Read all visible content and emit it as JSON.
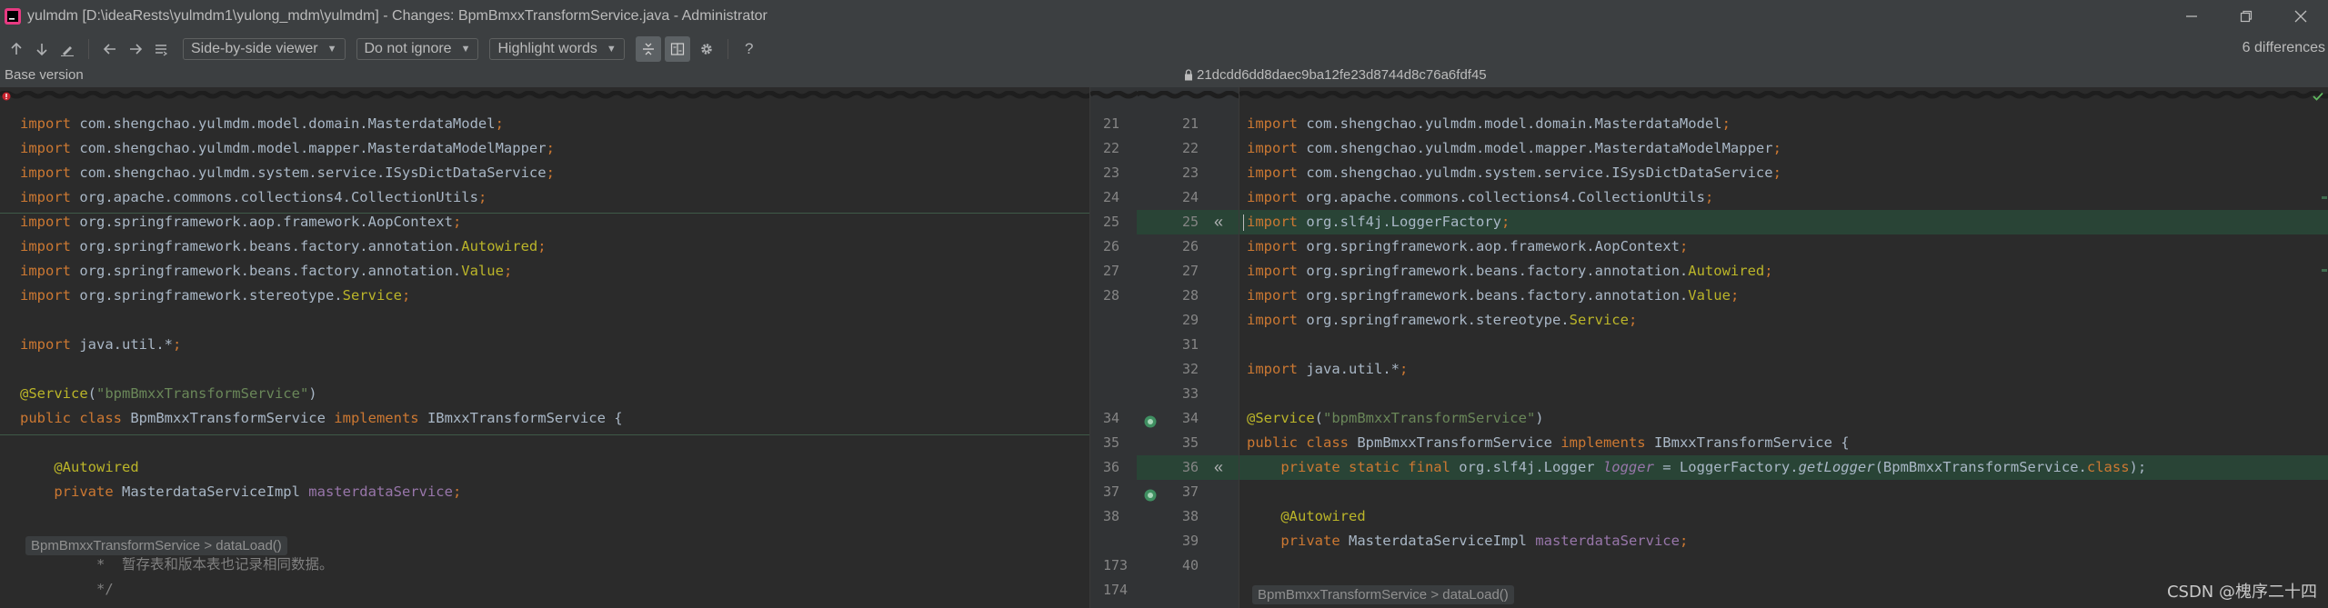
{
  "window": {
    "title": "yulmdm [D:\\ideaRests\\yulmdm1\\yulong_mdm\\yulmdm] - Changes: BpmBmxxTransformService.java - Administrator",
    "controls": [
      "minimize-icon",
      "restore-icon",
      "close-icon"
    ]
  },
  "toolbar": {
    "viewer_mode": "Side-by-side viewer",
    "whitespace_mode": "Do not ignore",
    "highlight_mode": "Highlight words",
    "help_label": "?",
    "differences_count": "6 differences"
  },
  "header": {
    "base_version": "Base version",
    "revision_hash": "21dcdd6dd8daec9ba12fe23d8744d8c76a6fdf45"
  },
  "left": {
    "lines": [
      {
        "tokens": [
          {
            "t": "import ",
            "c": "kw"
          },
          {
            "t": "com.shengchao.yulmdm.model.domain.MasterdataModel",
            "c": "pl"
          },
          {
            "t": ";",
            "c": "kw"
          }
        ]
      },
      {
        "tokens": [
          {
            "t": "import ",
            "c": "kw"
          },
          {
            "t": "com.shengchao.yulmdm.model.mapper.MasterdataModelMapper",
            "c": "pl"
          },
          {
            "t": ";",
            "c": "kw"
          }
        ]
      },
      {
        "tokens": [
          {
            "t": "import ",
            "c": "kw"
          },
          {
            "t": "com.shengchao.yulmdm.system.service.ISysDictDataService",
            "c": "pl"
          },
          {
            "t": ";",
            "c": "kw"
          }
        ]
      },
      {
        "tokens": [
          {
            "t": "import ",
            "c": "kw"
          },
          {
            "t": "org.apache.commons.collections4.CollectionUtils",
            "c": "pl"
          },
          {
            "t": ";",
            "c": "kw"
          }
        ]
      },
      {
        "tokens": [
          {
            "t": "import ",
            "c": "kw"
          },
          {
            "t": "org.springframework.aop.framework.AopContext",
            "c": "pl"
          },
          {
            "t": ";",
            "c": "kw"
          }
        ]
      },
      {
        "tokens": [
          {
            "t": "import ",
            "c": "kw"
          },
          {
            "t": "org.springframework.beans.factory.annotation.",
            "c": "pl"
          },
          {
            "t": "Autowired",
            "c": "an"
          },
          {
            "t": ";",
            "c": "kw"
          }
        ]
      },
      {
        "tokens": [
          {
            "t": "import ",
            "c": "kw"
          },
          {
            "t": "org.springframework.beans.factory.annotation.",
            "c": "pl"
          },
          {
            "t": "Value",
            "c": "an"
          },
          {
            "t": ";",
            "c": "kw"
          }
        ]
      },
      {
        "tokens": [
          {
            "t": "import ",
            "c": "kw"
          },
          {
            "t": "org.springframework.stereotype.",
            "c": "pl"
          },
          {
            "t": "Service",
            "c": "an"
          },
          {
            "t": ";",
            "c": "kw"
          }
        ]
      },
      {
        "tokens": []
      },
      {
        "tokens": [
          {
            "t": "import ",
            "c": "kw"
          },
          {
            "t": "java.util.*",
            "c": "pl"
          },
          {
            "t": ";",
            "c": "kw"
          }
        ]
      },
      {
        "tokens": []
      },
      {
        "tokens": [
          {
            "t": "@Service",
            "c": "an"
          },
          {
            "t": "(",
            "c": "pl"
          },
          {
            "t": "\"bpmBmxxTransformService\"",
            "c": "st"
          },
          {
            "t": ")",
            "c": "pl"
          }
        ]
      },
      {
        "tokens": [
          {
            "t": "public class ",
            "c": "kw"
          },
          {
            "t": "BpmBmxxTransformService ",
            "c": "pl"
          },
          {
            "t": "implements ",
            "c": "kw"
          },
          {
            "t": "IBmxxTransformService {",
            "c": "pl"
          }
        ]
      },
      {
        "tokens": []
      },
      {
        "tokens": [
          {
            "t": "    @Autowired",
            "c": "an"
          }
        ]
      },
      {
        "tokens": [
          {
            "t": "    private ",
            "c": "kw"
          },
          {
            "t": "MasterdataServiceImpl ",
            "c": "pl"
          },
          {
            "t": "masterdataService",
            "c": "fd"
          },
          {
            "t": ";",
            "c": "kw"
          }
        ]
      }
    ],
    "fold_label": "BpmBmxxTransformService > dataLoad()",
    "comment_lines": [
      "         *  暂存表和版本表也记录相同数据。",
      "         */"
    ]
  },
  "gutter": {
    "left_numbers": [
      "21",
      "22",
      "23",
      "24",
      "25",
      "26",
      "27",
      "28",
      "",
      "",
      "",
      "",
      "34",
      "35",
      "36",
      "37",
      "38",
      "",
      "173",
      "174"
    ],
    "right_numbers": [
      "21",
      "22",
      "23",
      "24",
      "25",
      "26",
      "27",
      "28",
      "29",
      "31",
      "32",
      "33",
      "34",
      "35",
      "36",
      "37",
      "38",
      "39",
      "40",
      ""
    ]
  },
  "right": {
    "lines": [
      {
        "tokens": [
          {
            "t": "import ",
            "c": "kw"
          },
          {
            "t": "com.shengchao.yulmdm.model.domain.MasterdataModel",
            "c": "pl"
          },
          {
            "t": ";",
            "c": "kw"
          }
        ]
      },
      {
        "tokens": [
          {
            "t": "import ",
            "c": "kw"
          },
          {
            "t": "com.shengchao.yulmdm.model.mapper.MasterdataModelMapper",
            "c": "pl"
          },
          {
            "t": ";",
            "c": "kw"
          }
        ]
      },
      {
        "tokens": [
          {
            "t": "import ",
            "c": "kw"
          },
          {
            "t": "com.shengchao.yulmdm.system.service.ISysDictDataService",
            "c": "pl"
          },
          {
            "t": ";",
            "c": "kw"
          }
        ]
      },
      {
        "tokens": [
          {
            "t": "import ",
            "c": "kw"
          },
          {
            "t": "org.apache.commons.collections4.CollectionUtils",
            "c": "pl"
          },
          {
            "t": ";",
            "c": "kw"
          }
        ]
      },
      {
        "tokens": [
          {
            "t": "import ",
            "c": "kw"
          },
          {
            "t": "org.slf4j.LoggerFactory",
            "c": "pl"
          },
          {
            "t": ";",
            "c": "kw"
          }
        ]
      },
      {
        "tokens": [
          {
            "t": "import ",
            "c": "kw"
          },
          {
            "t": "org.springframework.aop.framework.AopContext",
            "c": "pl"
          },
          {
            "t": ";",
            "c": "kw"
          }
        ]
      },
      {
        "tokens": [
          {
            "t": "import ",
            "c": "kw"
          },
          {
            "t": "org.springframework.beans.factory.annotation.",
            "c": "pl"
          },
          {
            "t": "Autowired",
            "c": "an"
          },
          {
            "t": ";",
            "c": "kw"
          }
        ]
      },
      {
        "tokens": [
          {
            "t": "import ",
            "c": "kw"
          },
          {
            "t": "org.springframework.beans.factory.annotation.",
            "c": "pl"
          },
          {
            "t": "Value",
            "c": "an"
          },
          {
            "t": ";",
            "c": "kw"
          }
        ]
      },
      {
        "tokens": [
          {
            "t": "import ",
            "c": "kw"
          },
          {
            "t": "org.springframework.stereotype.",
            "c": "pl"
          },
          {
            "t": "Service",
            "c": "an"
          },
          {
            "t": ";",
            "c": "kw"
          }
        ]
      },
      {
        "tokens": []
      },
      {
        "tokens": [
          {
            "t": "import ",
            "c": "kw"
          },
          {
            "t": "java.util.*",
            "c": "pl"
          },
          {
            "t": ";",
            "c": "kw"
          }
        ]
      },
      {
        "tokens": []
      },
      {
        "tokens": [
          {
            "t": "@Service",
            "c": "an"
          },
          {
            "t": "(",
            "c": "pl"
          },
          {
            "t": "\"bpmBmxxTransformService\"",
            "c": "st"
          },
          {
            "t": ")",
            "c": "pl"
          }
        ]
      },
      {
        "tokens": [
          {
            "t": "public class ",
            "c": "kw"
          },
          {
            "t": "BpmBmxxTransformService ",
            "c": "pl"
          },
          {
            "t": "implements ",
            "c": "kw"
          },
          {
            "t": "IBmxxTransformService {",
            "c": "pl"
          }
        ]
      },
      {
        "tokens": [
          {
            "t": "    private static final ",
            "c": "kw"
          },
          {
            "t": "org.slf4j.Logger ",
            "c": "pl"
          },
          {
            "t": "logger",
            "c": "fd it"
          },
          {
            "t": " = LoggerFactory.",
            "c": "pl"
          },
          {
            "t": "getLogger",
            "c": "pl it"
          },
          {
            "t": "(BpmBmxxTransformService.",
            "c": "pl"
          },
          {
            "t": "class",
            "c": "kw"
          },
          {
            "t": ");",
            "c": "pl"
          }
        ]
      },
      {
        "tokens": []
      },
      {
        "tokens": [
          {
            "t": "    @Autowired",
            "c": "an"
          }
        ]
      },
      {
        "tokens": [
          {
            "t": "    private ",
            "c": "kw"
          },
          {
            "t": "MasterdataServiceImpl ",
            "c": "pl"
          },
          {
            "t": "masterdataService",
            "c": "fd"
          },
          {
            "t": ";",
            "c": "kw"
          }
        ]
      }
    ],
    "fold_label": "BpmBmxxTransformService > dataLoad()"
  },
  "watermark": "CSDN @槐序二十四",
  "colors": {
    "accent_insert": "#294436",
    "keyword": "#cc7832",
    "annotation": "#bbb529",
    "string": "#6a8759",
    "field": "#9876aa"
  }
}
